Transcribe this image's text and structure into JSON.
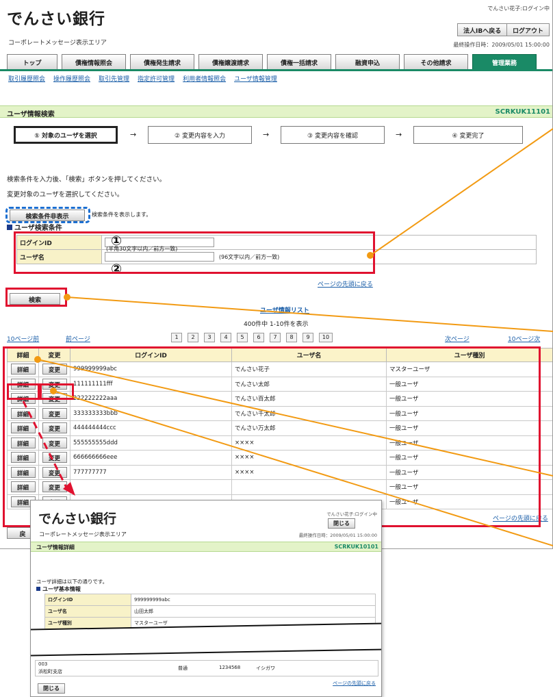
{
  "header": {
    "bank_name": "でんさい銀行",
    "area_label": "コーポレートメッセージ表示エリア",
    "user_name": "でんさい花子:ログイン中",
    "btn_corp_ib": "法人IBへ戻る",
    "btn_logout": "ログアウト",
    "last_operation": "最終操作日時：2009/05/01 15:00:00"
  },
  "tabs": [
    "トップ",
    "債権情報照会",
    "債権発生請求",
    "債権譲渡請求",
    "債権一括請求",
    "融資申込",
    "その他請求",
    "管理業務"
  ],
  "subnav": [
    "取引履歴照会",
    "操作履歴照会",
    "取引先管理",
    "指定許可管理",
    "利用者情報照会",
    "ユーザ情報管理"
  ],
  "page": {
    "title": "ユーザ情報検索",
    "code": "SCRKUK11101"
  },
  "steps": [
    "① 対象のユーザを選択",
    "② 変更内容を入力",
    "③ 変更内容を確認",
    "④ 変更完了"
  ],
  "step_arrow": "→",
  "notes": [
    "検索条件を入力後、「検索」ボタンを押してください。",
    "変更対象のユーザを選択してください。"
  ],
  "search_toggle": {
    "button": "検索条件非表示",
    "caption": "検索条件を表示します。"
  },
  "search_section": "ユーザ検索条件",
  "search": {
    "login_label": "ログインID",
    "login_hint": "(半角30文字以内／前方一致)",
    "name_label": "ユーザ名",
    "name_hint": "(96文字以内／前方一致)",
    "marker1": "①",
    "marker2": "②",
    "back_top": "ページの先頭に戻る",
    "search_button": "検索"
  },
  "list": {
    "title": "ユーザ情報リスト",
    "summary": "400件中 1-10件を表示",
    "prev10": "10ページ前",
    "prev": "前ページ",
    "next": "次ページ",
    "next10": "10ページ次",
    "pages": [
      "1",
      "2",
      "3",
      "4",
      "5",
      "6",
      "7",
      "8",
      "9",
      "10"
    ],
    "headers": [
      "詳細",
      "変更",
      "ログインID",
      "ユーザ名",
      "ユーザ種別"
    ],
    "detail_label": "詳細",
    "change_label": "変更",
    "rows": [
      [
        "999999999abc",
        "でんさい花子",
        "マスターユーザ"
      ],
      [
        "111111111fff",
        "でんさい太郎",
        "一般ユーザ"
      ],
      [
        "222222222aaa",
        "でんさい百太郎",
        "一般ユーザ"
      ],
      [
        "333333333bbb",
        "でんさい千太郎",
        "一般ユーザ"
      ],
      [
        "444444444ccc",
        "でんさい万太郎",
        "一般ユーザ"
      ],
      [
        "555555555ddd",
        "××××",
        "一般ユーザ"
      ],
      [
        "666666666eee",
        "××××",
        "一般ユーザ"
      ],
      [
        "777777777",
        "××××",
        "一般ユーザ"
      ],
      [
        "",
        "",
        "一般ユーザ"
      ],
      [
        "",
        "",
        "一般ユーザ"
      ]
    ],
    "back_top": "ページの先頭に戻る",
    "back_button": "戻"
  },
  "popup": {
    "bank_name": "でんさい銀行",
    "area_label": "コーポレートメッセージ表示エリア",
    "user_name": "でんさい花子:ログイン中",
    "close_button": "閉じる",
    "last_operation": "最終操作日時：2009/05/01 15:00:00",
    "title": "ユーザ情報詳細",
    "code": "SCRKUK10101",
    "note": "ユーザ詳細は以下の通りです。",
    "section": "ユーザ基本情報",
    "login_label": "ログインID",
    "login_value": "999999999abc",
    "name_label": "ユーザ名",
    "name_value": "山田太郎",
    "type_label": "ユーザ種別",
    "type_value": "マスターユーザ",
    "branch_code": "003",
    "branch_name": "浜松町支店",
    "account_type": "普通",
    "account_no": "1234568",
    "account_holder": "イシガワ",
    "back_top": "ページの先頭に戻る"
  },
  "colors": {
    "accent": "#1a8a66",
    "highlight": "#e0112f",
    "callout": "#f29a12",
    "dashed": "#1c6fd1"
  }
}
